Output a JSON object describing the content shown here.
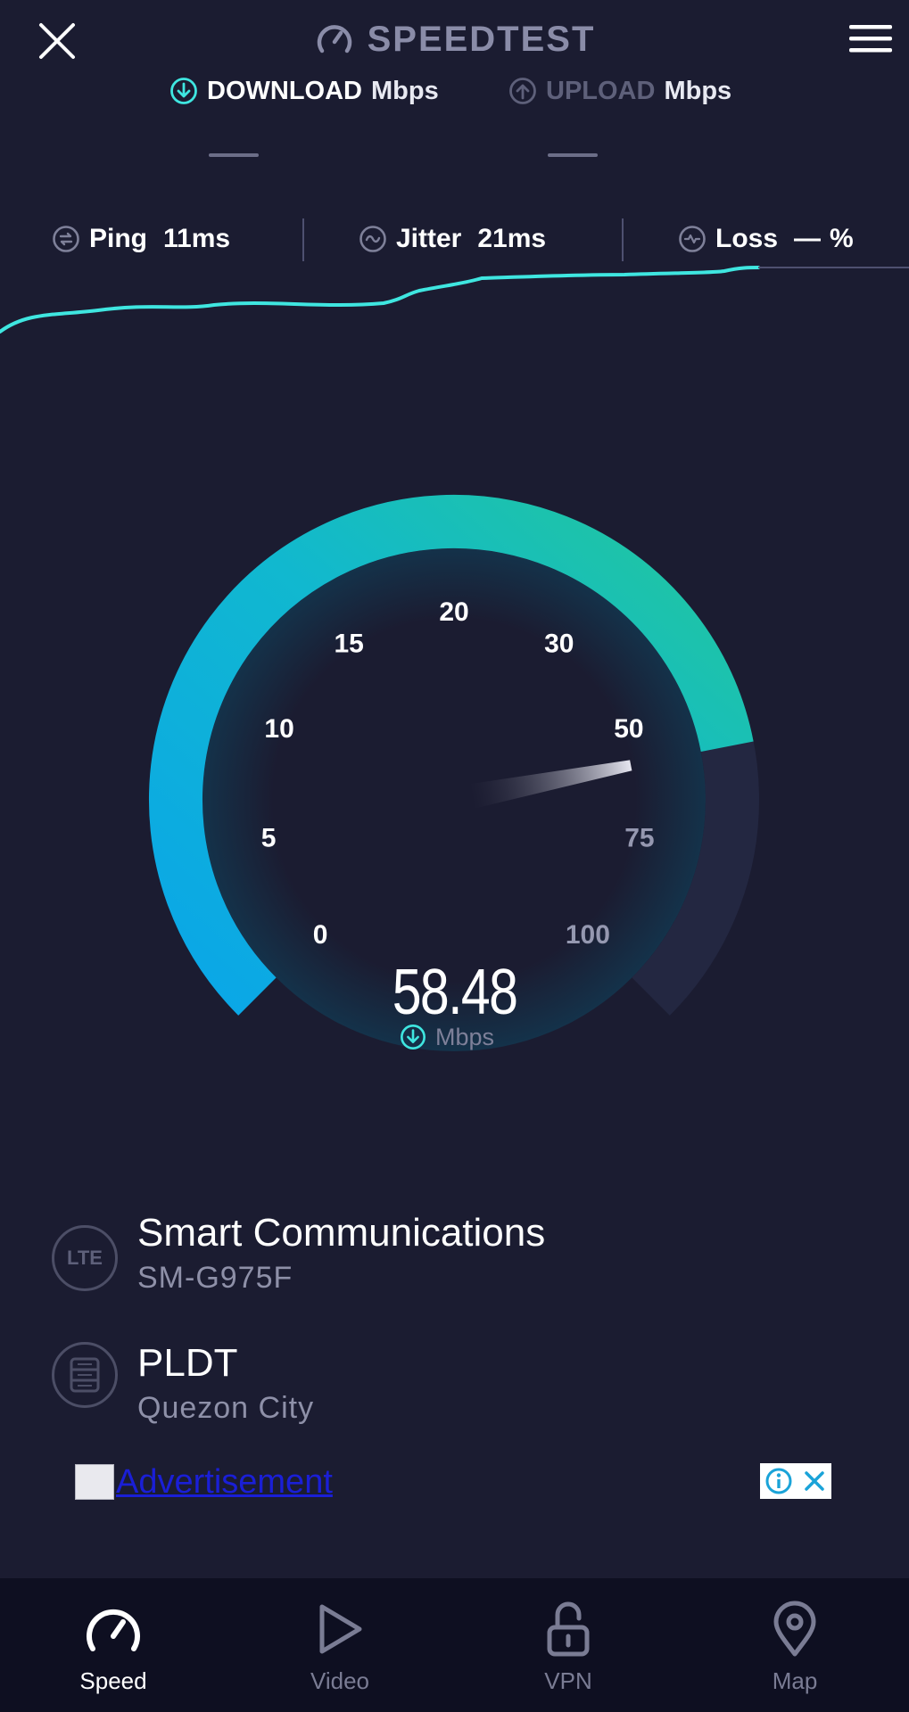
{
  "header": {
    "brand": "SPEEDTEST",
    "close_icon": "close-icon",
    "menu_icon": "hamburger-menu-icon"
  },
  "tabs": {
    "download": {
      "label": "DOWNLOAD",
      "unit": "Mbps",
      "value": "—",
      "icon": "download-arrow-icon"
    },
    "upload": {
      "label": "UPLOAD",
      "unit": "Mbps",
      "value": "—",
      "icon": "upload-arrow-icon"
    }
  },
  "stats": {
    "ping": {
      "label": "Ping",
      "value": "11ms"
    },
    "jitter": {
      "label": "Jitter",
      "value": "21ms"
    },
    "loss": {
      "label": "Loss",
      "value": "—",
      "unit": "%"
    }
  },
  "gauge": {
    "ticks": [
      "0",
      "5",
      "10",
      "15",
      "20",
      "30",
      "50",
      "75",
      "100"
    ],
    "current_value": "58.48",
    "unit": "Mbps",
    "max": 100
  },
  "connection": {
    "provider_badge": "LTE",
    "provider_name": "Smart Communications",
    "device": "SM-G975F",
    "server_name": "PLDT",
    "server_location": "Quezon City"
  },
  "ad": {
    "link_text": "Advertisement"
  },
  "bottom_nav": [
    {
      "label": "Speed",
      "icon": "speedometer-icon",
      "active": true
    },
    {
      "label": "Video",
      "icon": "play-icon",
      "active": false
    },
    {
      "label": "VPN",
      "icon": "unlock-icon",
      "active": false
    },
    {
      "label": "Map",
      "icon": "map-pin-icon",
      "active": false
    }
  ],
  "colors": {
    "background": "#1b1c31",
    "accent_teal": "#3fe6e0",
    "gauge_start": "#0aa6e8",
    "gauge_end": "#1fc3a0",
    "gauge_track": "#232741"
  }
}
